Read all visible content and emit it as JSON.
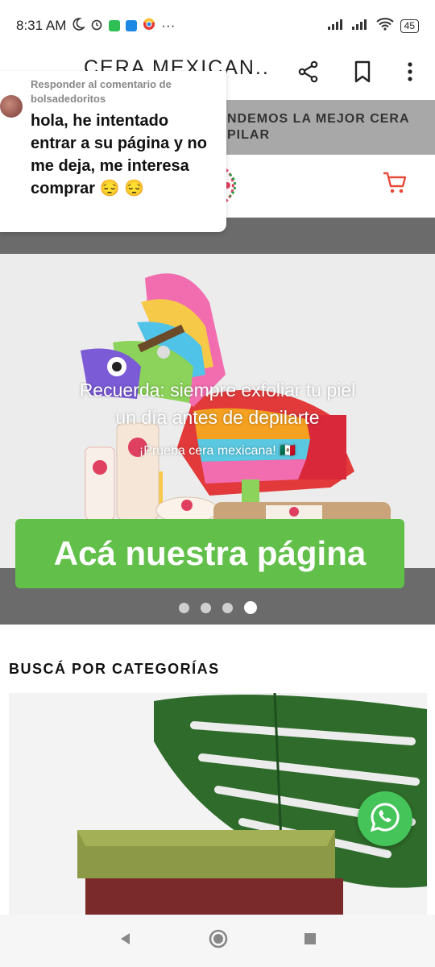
{
  "status_bar": {
    "time": "8:31 AM",
    "more": "···",
    "battery": "45",
    "icons": [
      "moon-icon",
      "alarm-icon",
      "whatsapp-notif-icon",
      "app-notif-icon",
      "chrome-icon",
      "signal-icon",
      "signal-icon-2",
      "wifi-icon",
      "battery-icon"
    ]
  },
  "topbar": {
    "title": "CERA MEXICAN...",
    "icons": [
      "share-icon",
      "bookmark-icon",
      "more-vert-icon"
    ]
  },
  "banner": {
    "text_line1": "NDEMOS LA MEJOR CERA",
    "text_line2": "PILAR"
  },
  "comment": {
    "reply_label": "Responder al comentario de bolsadedoritos",
    "text": "hola, he intentado entrar a su página y no me deja, me interesa comprar 😔 😔"
  },
  "hero": {
    "caption_line1": "Recuerda: siempre exfoliar tu piel",
    "caption_line2": "un día antes de depilarte",
    "subcaption": "¡Prueba cera mexicana! 🇲🇽",
    "cta": "Acá nuestra página",
    "slides_total": 4,
    "active_slide": 4
  },
  "categories": {
    "title": "BUSCÁ POR CATEGORÍAS"
  },
  "colors": {
    "cta_green": "#62c04a",
    "whatsapp_green": "#45c45a",
    "cart_red": "#e84a3a"
  }
}
